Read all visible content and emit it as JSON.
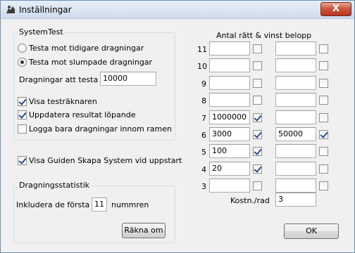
{
  "window": {
    "title": "Inställningar",
    "close_label": "X"
  },
  "systemtest": {
    "group_title": "SystemTest",
    "radio_tidigare": "Testa mot tidigare dragningar",
    "radio_slumpade": "Testa mot slumpade dragningar",
    "dragningar_label": "Dragningar att testa",
    "dragningar_value": "10000",
    "visa_testraknaren": "Visa testräknaren",
    "uppdatera_resultat": "Uppdatera resultat löpande",
    "logga_bara": "Logga bara dragningar innom ramen"
  },
  "visa_guiden": "Visa Guiden Skapa System vid uppstart",
  "statistik": {
    "group_title": "Dragningsstatistik",
    "inkludera_label": "Inkludera de första",
    "inkludera_value": "11",
    "nummren_label": "nummren",
    "rakna_om_button": "Räkna om"
  },
  "belopp": {
    "title": "Antal rätt & vinst belopp",
    "rows": [
      {
        "n": "11",
        "left_value": "",
        "left_checked": false,
        "right_value": "",
        "right_checked": false
      },
      {
        "n": "10",
        "left_value": "",
        "left_checked": false,
        "right_value": "",
        "right_checked": false
      },
      {
        "n": "9",
        "left_value": "",
        "left_checked": false,
        "right_value": "",
        "right_checked": false
      },
      {
        "n": "8",
        "left_value": "",
        "left_checked": false,
        "right_value": "",
        "right_checked": false
      },
      {
        "n": "7",
        "left_value": "1000000",
        "left_checked": true,
        "right_value": "",
        "right_checked": false
      },
      {
        "n": "6",
        "left_value": "3000",
        "left_checked": true,
        "right_value": "50000",
        "right_checked": true
      },
      {
        "n": "5",
        "left_value": "100",
        "left_checked": true,
        "right_value": "",
        "right_checked": false
      },
      {
        "n": "4",
        "left_value": "20",
        "left_checked": true,
        "right_value": "",
        "right_checked": false
      },
      {
        "n": "3",
        "left_value": "",
        "left_checked": false,
        "right_value": "",
        "right_checked": false
      }
    ],
    "kostn_label": "Kostn./rad",
    "kostn_value": "3"
  },
  "ok_button": "OK"
}
